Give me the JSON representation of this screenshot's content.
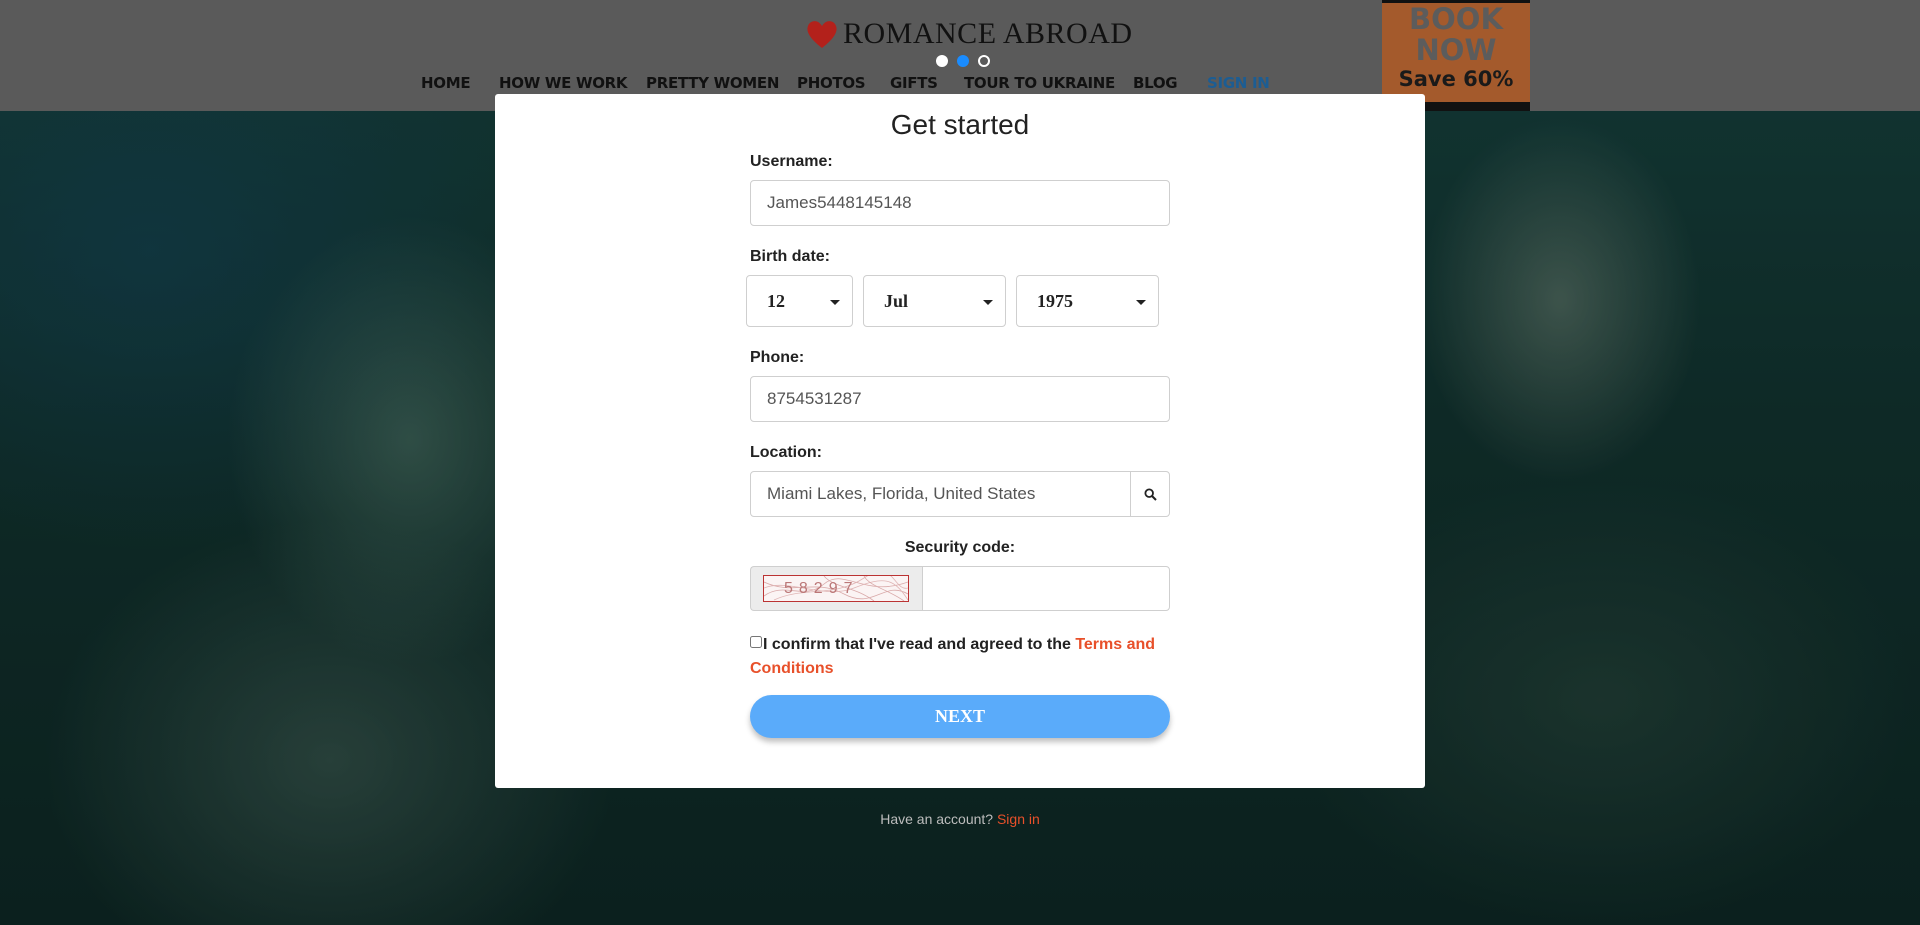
{
  "header": {
    "logo_text": "ROMANCE ABROAD",
    "carousel_dots": 3,
    "active_dot": 2,
    "nav": [
      {
        "label": "HOME"
      },
      {
        "label": "HOW WE WORK"
      },
      {
        "label": "PRETTY WOMEN"
      },
      {
        "label": "PHOTOS"
      },
      {
        "label": "GIFTS"
      },
      {
        "label": "TOUR TO UKRAINE"
      },
      {
        "label": "BLOG"
      },
      {
        "label": "SIGN IN"
      }
    ],
    "book": {
      "title": "BOOK\nNOW",
      "save": "Save 60%"
    }
  },
  "modal": {
    "title": "Get started",
    "username_label": "Username:",
    "username_value": "James5448145148",
    "birth_label": "Birth date:",
    "birth_day": "12",
    "birth_month": "Jul",
    "birth_year": "1975",
    "phone_label": "Phone:",
    "phone_value": "8754531287",
    "location_label": "Location:",
    "location_value": "Miami Lakes, Florida, United States",
    "security_label": "Security code:",
    "captcha_text": "58297",
    "agree_text": "I confirm that I've read and agreed to the ",
    "terms_link": "Terms and Conditions",
    "next_label": "NEXT"
  },
  "footer": {
    "have_account": "Have an account? ",
    "signin_link": "Sign in"
  },
  "colors": {
    "accent": "#5aabfa",
    "link": "#e8502a",
    "header_bg": "#5a5a5a",
    "book_bg": "#a45a2c",
    "logo_heart": "#b3211b"
  }
}
